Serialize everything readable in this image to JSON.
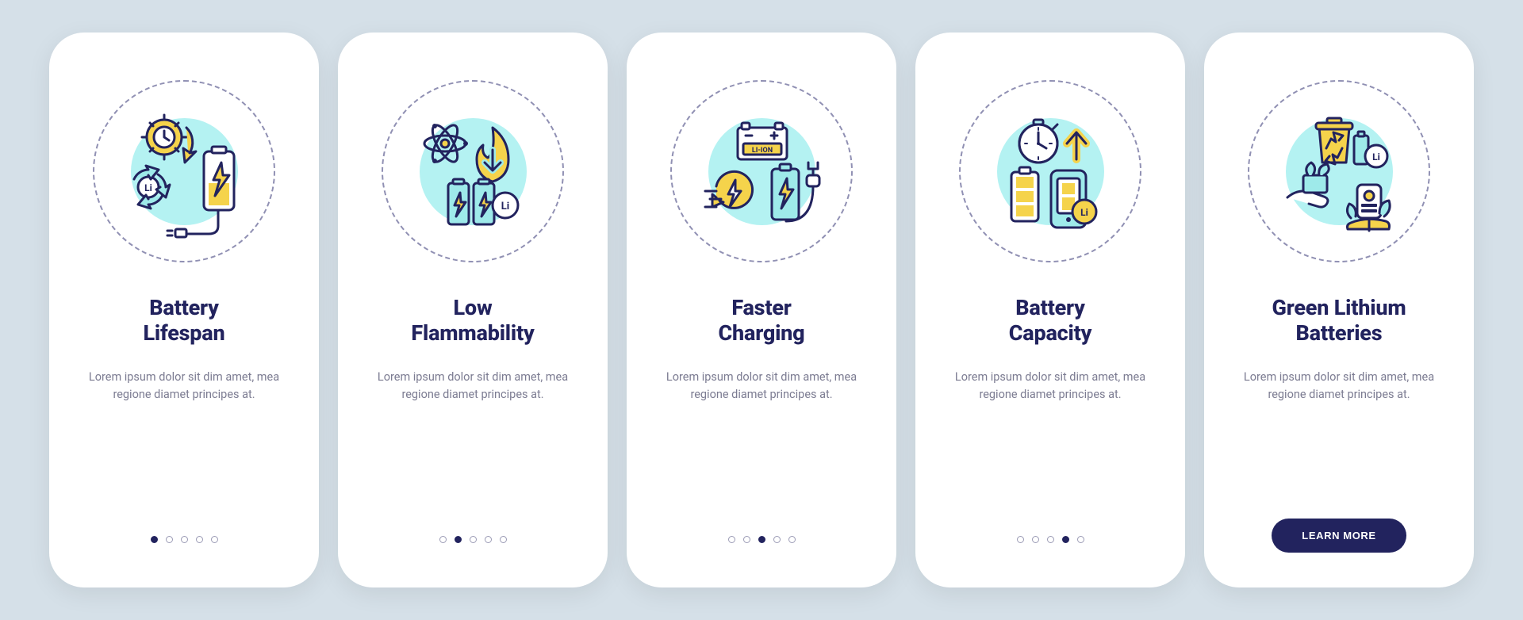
{
  "colors": {
    "navy": "#22235e",
    "yellow": "#f5d34b",
    "cyan": "#9eeaea",
    "gray": "#7c7c92"
  },
  "cards": [
    {
      "title_line1": "Battery",
      "title_line2": "Lifespan",
      "desc": "Lorem ipsum dolor sit dim amet, mea regione diamet principes at.",
      "activeDot": 0,
      "icon": "battery-lifespan-icon"
    },
    {
      "title_line1": "Low",
      "title_line2": "Flammability",
      "desc": "Lorem ipsum dolor sit dim amet, mea regione diamet principes at.",
      "activeDot": 1,
      "icon": "low-flammability-icon"
    },
    {
      "title_line1": "Faster",
      "title_line2": "Charging",
      "desc": "Lorem ipsum dolor sit dim amet, mea regione diamet principes at.",
      "activeDot": 2,
      "icon": "faster-charging-icon"
    },
    {
      "title_line1": "Battery",
      "title_line2": "Capacity",
      "desc": "Lorem ipsum dolor sit dim amet, mea regione diamet principes at.",
      "activeDot": 3,
      "icon": "battery-capacity-icon"
    },
    {
      "title_line1": "Green Lithium",
      "title_line2": "Batteries",
      "desc": "Lorem ipsum dolor sit dim amet, mea regione diamet principes at.",
      "activeDot": 4,
      "icon": "green-lithium-icon",
      "ctaLabel": "LEARN MORE"
    }
  ],
  "dotCount": 5
}
